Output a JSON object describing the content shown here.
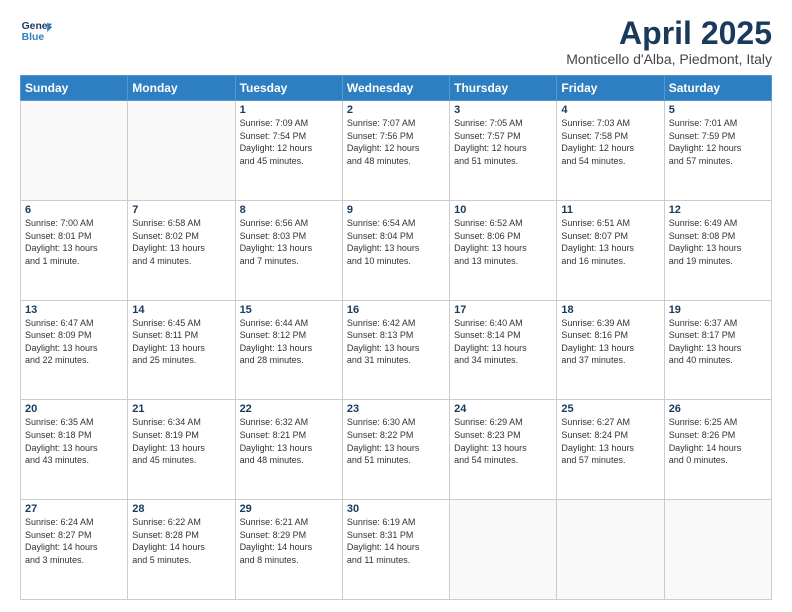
{
  "header": {
    "logo_line1": "General",
    "logo_line2": "Blue",
    "month_title": "April 2025",
    "location": "Monticello d'Alba, Piedmont, Italy"
  },
  "days_of_week": [
    "Sunday",
    "Monday",
    "Tuesday",
    "Wednesday",
    "Thursday",
    "Friday",
    "Saturday"
  ],
  "weeks": [
    [
      {
        "day": "",
        "info": ""
      },
      {
        "day": "",
        "info": ""
      },
      {
        "day": "1",
        "info": "Sunrise: 7:09 AM\nSunset: 7:54 PM\nDaylight: 12 hours\nand 45 minutes."
      },
      {
        "day": "2",
        "info": "Sunrise: 7:07 AM\nSunset: 7:56 PM\nDaylight: 12 hours\nand 48 minutes."
      },
      {
        "day": "3",
        "info": "Sunrise: 7:05 AM\nSunset: 7:57 PM\nDaylight: 12 hours\nand 51 minutes."
      },
      {
        "day": "4",
        "info": "Sunrise: 7:03 AM\nSunset: 7:58 PM\nDaylight: 12 hours\nand 54 minutes."
      },
      {
        "day": "5",
        "info": "Sunrise: 7:01 AM\nSunset: 7:59 PM\nDaylight: 12 hours\nand 57 minutes."
      }
    ],
    [
      {
        "day": "6",
        "info": "Sunrise: 7:00 AM\nSunset: 8:01 PM\nDaylight: 13 hours\nand 1 minute."
      },
      {
        "day": "7",
        "info": "Sunrise: 6:58 AM\nSunset: 8:02 PM\nDaylight: 13 hours\nand 4 minutes."
      },
      {
        "day": "8",
        "info": "Sunrise: 6:56 AM\nSunset: 8:03 PM\nDaylight: 13 hours\nand 7 minutes."
      },
      {
        "day": "9",
        "info": "Sunrise: 6:54 AM\nSunset: 8:04 PM\nDaylight: 13 hours\nand 10 minutes."
      },
      {
        "day": "10",
        "info": "Sunrise: 6:52 AM\nSunset: 8:06 PM\nDaylight: 13 hours\nand 13 minutes."
      },
      {
        "day": "11",
        "info": "Sunrise: 6:51 AM\nSunset: 8:07 PM\nDaylight: 13 hours\nand 16 minutes."
      },
      {
        "day": "12",
        "info": "Sunrise: 6:49 AM\nSunset: 8:08 PM\nDaylight: 13 hours\nand 19 minutes."
      }
    ],
    [
      {
        "day": "13",
        "info": "Sunrise: 6:47 AM\nSunset: 8:09 PM\nDaylight: 13 hours\nand 22 minutes."
      },
      {
        "day": "14",
        "info": "Sunrise: 6:45 AM\nSunset: 8:11 PM\nDaylight: 13 hours\nand 25 minutes."
      },
      {
        "day": "15",
        "info": "Sunrise: 6:44 AM\nSunset: 8:12 PM\nDaylight: 13 hours\nand 28 minutes."
      },
      {
        "day": "16",
        "info": "Sunrise: 6:42 AM\nSunset: 8:13 PM\nDaylight: 13 hours\nand 31 minutes."
      },
      {
        "day": "17",
        "info": "Sunrise: 6:40 AM\nSunset: 8:14 PM\nDaylight: 13 hours\nand 34 minutes."
      },
      {
        "day": "18",
        "info": "Sunrise: 6:39 AM\nSunset: 8:16 PM\nDaylight: 13 hours\nand 37 minutes."
      },
      {
        "day": "19",
        "info": "Sunrise: 6:37 AM\nSunset: 8:17 PM\nDaylight: 13 hours\nand 40 minutes."
      }
    ],
    [
      {
        "day": "20",
        "info": "Sunrise: 6:35 AM\nSunset: 8:18 PM\nDaylight: 13 hours\nand 43 minutes."
      },
      {
        "day": "21",
        "info": "Sunrise: 6:34 AM\nSunset: 8:19 PM\nDaylight: 13 hours\nand 45 minutes."
      },
      {
        "day": "22",
        "info": "Sunrise: 6:32 AM\nSunset: 8:21 PM\nDaylight: 13 hours\nand 48 minutes."
      },
      {
        "day": "23",
        "info": "Sunrise: 6:30 AM\nSunset: 8:22 PM\nDaylight: 13 hours\nand 51 minutes."
      },
      {
        "day": "24",
        "info": "Sunrise: 6:29 AM\nSunset: 8:23 PM\nDaylight: 13 hours\nand 54 minutes."
      },
      {
        "day": "25",
        "info": "Sunrise: 6:27 AM\nSunset: 8:24 PM\nDaylight: 13 hours\nand 57 minutes."
      },
      {
        "day": "26",
        "info": "Sunrise: 6:25 AM\nSunset: 8:26 PM\nDaylight: 14 hours\nand 0 minutes."
      }
    ],
    [
      {
        "day": "27",
        "info": "Sunrise: 6:24 AM\nSunset: 8:27 PM\nDaylight: 14 hours\nand 3 minutes."
      },
      {
        "day": "28",
        "info": "Sunrise: 6:22 AM\nSunset: 8:28 PM\nDaylight: 14 hours\nand 5 minutes."
      },
      {
        "day": "29",
        "info": "Sunrise: 6:21 AM\nSunset: 8:29 PM\nDaylight: 14 hours\nand 8 minutes."
      },
      {
        "day": "30",
        "info": "Sunrise: 6:19 AM\nSunset: 8:31 PM\nDaylight: 14 hours\nand 11 minutes."
      },
      {
        "day": "",
        "info": ""
      },
      {
        "day": "",
        "info": ""
      },
      {
        "day": "",
        "info": ""
      }
    ]
  ]
}
